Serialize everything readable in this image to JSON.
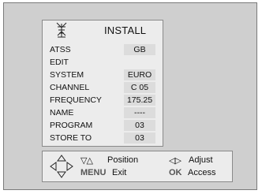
{
  "menu": {
    "title": "INSTALL",
    "icon": "antenna-icon",
    "rows": [
      {
        "label": "ATSS",
        "value": "GB"
      },
      {
        "label": "EDIT",
        "value": ""
      },
      {
        "label": "SYSTEM",
        "value": "EURO"
      },
      {
        "label": "CHANNEL",
        "value": "C 05"
      },
      {
        "label": "FREQUENCY",
        "value": "175.25"
      },
      {
        "label": "NAME",
        "value": "----"
      },
      {
        "label": "PROGRAM",
        "value": "03"
      },
      {
        "label": "STORE TO",
        "value": "03"
      }
    ]
  },
  "help": {
    "nav_icon": "dpad-icon",
    "updown_glyph": "▽△",
    "leftright_glyph": "◁▷",
    "position_label": "Position",
    "adjust_label": "Adjust",
    "menu_key": "MENU",
    "exit_label": "Exit",
    "ok_key": "OK",
    "access_label": "Access"
  },
  "colors": {
    "screen_bg": "#cfcfcf",
    "panel_bg": "#ececec",
    "value_bg": "#dcdcdc",
    "key_text": "#555555"
  }
}
